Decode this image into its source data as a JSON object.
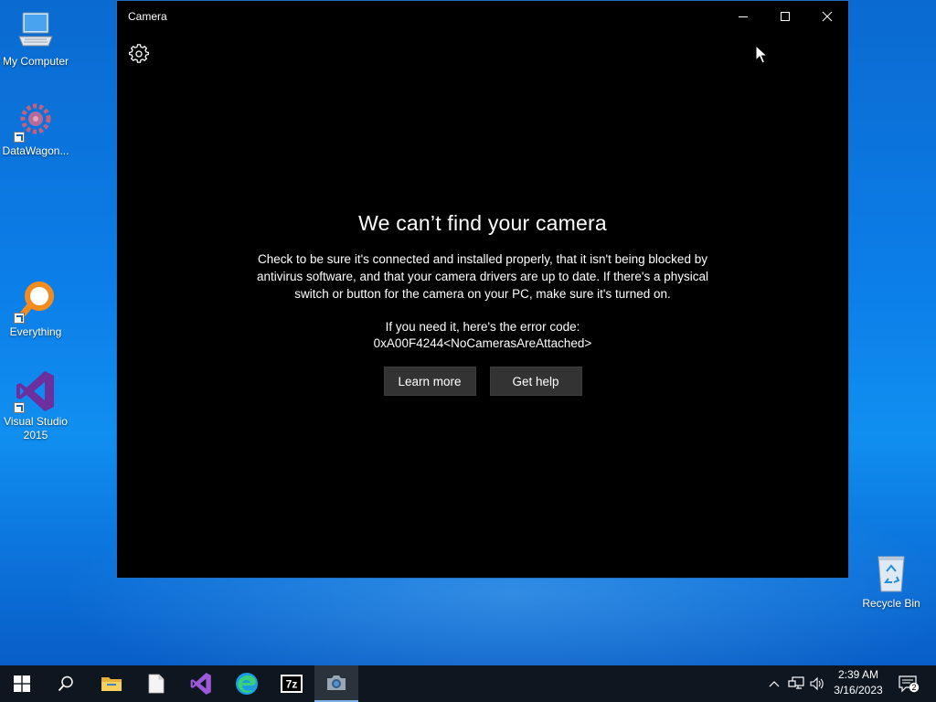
{
  "desktop": {
    "icons": [
      {
        "label": "My Computer"
      },
      {
        "label": "DataWagon..."
      },
      {
        "label": "Everything"
      },
      {
        "label": "Visual Studio 2015"
      },
      {
        "label": "Recycle Bin"
      }
    ]
  },
  "window": {
    "title": "Camera",
    "heading": "We can’t find your camera",
    "description": "Check to be sure it's connected and installed properly, that it isn't being blocked by antivirus software, and that your camera drivers are up to date. If there's a physical switch or button for the camera on your PC, make sure it's turned on.",
    "error_label": "If you need it, here's the error code:",
    "error_code": "0xA00F4244<NoCamerasAreAttached>",
    "buttons": {
      "learn_more": "Learn more",
      "get_help": "Get help"
    }
  },
  "taskbar": {
    "items": [
      "start-icon",
      "search-icon",
      "file-explorer-icon",
      "notepad-icon",
      "visual-studio-icon",
      "edge-icon",
      "7zip-icon",
      "camera-icon"
    ],
    "active_item": "camera-icon",
    "zip_label": "7z",
    "clock": {
      "time": "2:39 AM",
      "date": "3/16/2023"
    },
    "notification_count": "2"
  },
  "colors": {
    "window_bg": "#000000",
    "button_bg": "#333333",
    "taskbar_bg": "#0e1720",
    "accent": "#0c7ee8"
  }
}
